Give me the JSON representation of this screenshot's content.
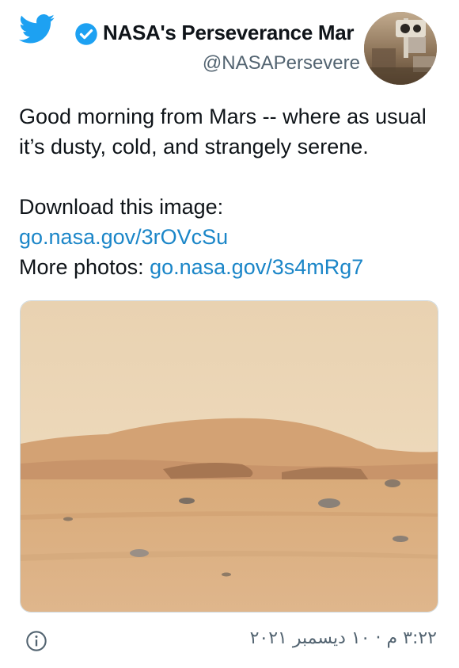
{
  "tweet": {
    "author": {
      "display_name": "NASA's Perseverance Mar",
      "handle": "@NASAPersevere",
      "verified": true
    },
    "body": {
      "line1": "Good morning from Mars -- where as usual it’s dusty, cold, and strangely serene.",
      "download_label": "Download this image:",
      "download_link": "go.nasa.gov/3rOVcSu",
      "more_label": "More photos: ",
      "more_link": "go.nasa.gov/3s4mRg7"
    },
    "timestamp": "٣:٢٢ م · ١٠ ديسمبر ٢٠٢١"
  },
  "icons": {
    "brand": "twitter-bird-icon",
    "verified": "verified-badge-icon",
    "info": "info-icon"
  },
  "colors": {
    "brand": "#1da1f2",
    "link": "#1b86c8",
    "secondary_text": "#536471"
  }
}
